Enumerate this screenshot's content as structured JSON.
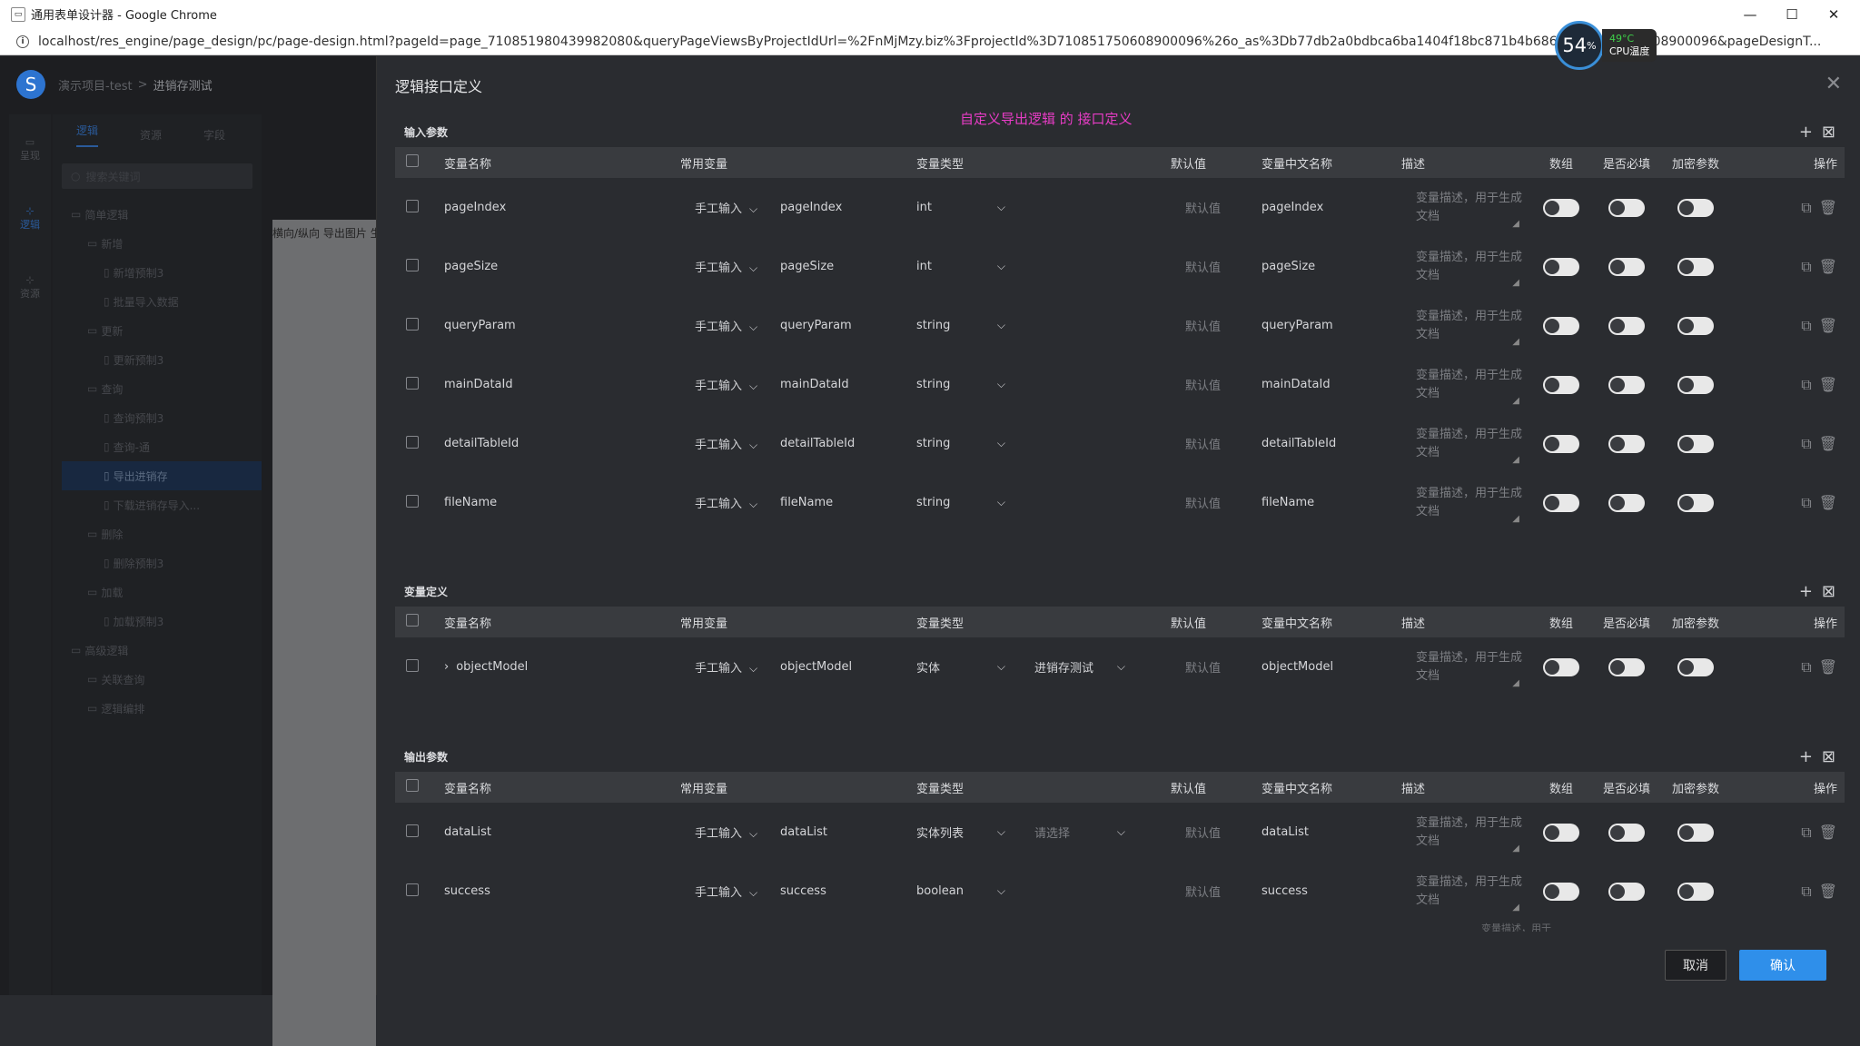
{
  "browser": {
    "window_title": "通用表单设计器 - Google Chrome",
    "url": "localhost/res_engine/page_design/pc/page-design.html?pageId=page_710851980439982080&queryPageViewsByProjectIdUrl=%2FnMjMzy.biz%3FprojectId%3D710851750608900096%26o_as%3Db77db2a0bdbca6ba1404f18bc871b4b68647c06f&pr 50608900096&pageDesignT...",
    "cpu_percent": "54",
    "cpu_unit": "%",
    "cpu_temp": "49°C",
    "cpu_label": "CPU温度"
  },
  "app": {
    "logo": "S",
    "breadcrumb_project": "演示项目-test",
    "breadcrumb_sep": ">",
    "breadcrumb_page": "进销存测试",
    "iconbar": [
      "呈现",
      "逻辑",
      "资源"
    ],
    "tree_tabs": [
      "逻辑",
      "资源",
      "字段"
    ],
    "tree_search_placeholder": "搜索关键词",
    "tree_items": [
      {
        "label": "简单逻辑",
        "indent": 0
      },
      {
        "label": "新增",
        "indent": 1
      },
      {
        "label": "新增预制3",
        "indent": 2
      },
      {
        "label": "批量导入数据",
        "indent": 2
      },
      {
        "label": "更新",
        "indent": 1
      },
      {
        "label": "更新预制3",
        "indent": 2
      },
      {
        "label": "查询",
        "indent": 1
      },
      {
        "label": "查询预制3",
        "indent": 2
      },
      {
        "label": "查询-通",
        "indent": 2
      },
      {
        "label": "导出进销存",
        "indent": 2
      },
      {
        "label": "下载进销存导入...",
        "indent": 2
      },
      {
        "label": "删除",
        "indent": 1
      },
      {
        "label": "删除预制3",
        "indent": 2
      },
      {
        "label": "加载",
        "indent": 1
      },
      {
        "label": "加载预制3",
        "indent": 2
      },
      {
        "label": "高级逻辑",
        "indent": 0
      },
      {
        "label": "关联查询",
        "indent": 1
      },
      {
        "label": "逻辑编排",
        "indent": 1
      }
    ],
    "canvas_label": "横向/纵向 导出图片 生"
  },
  "drawer": {
    "title": "逻辑接口定义",
    "annotation": "自定义导出逻辑 的 接口定义",
    "cancel_label": "取消",
    "ok_label": "确认",
    "headers": {
      "name": "变量名称",
      "common": "常用变量",
      "type": "变量类型",
      "default": "默认值",
      "cn_name": "变量中文名称",
      "desc": "描述",
      "array": "数组",
      "required": "是否必填",
      "encrypt": "加密参数",
      "ops": "操作"
    },
    "input_section": {
      "title": "输入参数",
      "rows": [
        {
          "name": "pageIndex",
          "common": "手工输入",
          "var": "pageIndex",
          "type": "int",
          "default": "默认值",
          "cn_name": "pageIndex",
          "desc": "变量描述，用于生成文档"
        },
        {
          "name": "pageSize",
          "common": "手工输入",
          "var": "pageSize",
          "type": "int",
          "default": "默认值",
          "cn_name": "pageSize",
          "desc": "变量描述，用于生成文档"
        },
        {
          "name": "queryParam",
          "common": "手工输入",
          "var": "queryParam",
          "type": "string",
          "default": "默认值",
          "cn_name": "queryParam",
          "desc": "变量描述，用于生成文档"
        },
        {
          "name": "mainDataId",
          "common": "手工输入",
          "var": "mainDataId",
          "type": "string",
          "default": "默认值",
          "cn_name": "mainDataId",
          "desc": "变量描述，用于生成文档"
        },
        {
          "name": "detailTableId",
          "common": "手工输入",
          "var": "detailTableId",
          "type": "string",
          "default": "默认值",
          "cn_name": "detailTableId",
          "desc": "变量描述，用于生成文档"
        },
        {
          "name": "fileName",
          "common": "手工输入",
          "var": "fileName",
          "type": "string",
          "default": "默认值",
          "cn_name": "fileName",
          "desc": "变量描述，用于生成文档"
        }
      ]
    },
    "var_section": {
      "title": "变量定义",
      "rows": [
        {
          "name": "objectModel",
          "expand": "›",
          "common": "手工输入",
          "var": "objectModel",
          "type": "实体",
          "ref": "进销存测试",
          "default": "默认值",
          "cn_name": "objectModel",
          "desc": "变量描述，用于生成文档"
        }
      ]
    },
    "output_section": {
      "title": "输出参数",
      "rows": [
        {
          "name": "dataList",
          "common": "手工输入",
          "var": "dataList",
          "type": "实体列表",
          "ref": "请选择",
          "default": "默认值",
          "cn_name": "dataList",
          "desc": "变量描述，用于生成文档"
        },
        {
          "name": "success",
          "common": "手工输入",
          "var": "success",
          "type": "boolean",
          "default": "默认值",
          "cn_name": "success",
          "desc": "变量描述，用于生成文档"
        }
      ],
      "partial_desc": "变量描述，用于"
    }
  }
}
